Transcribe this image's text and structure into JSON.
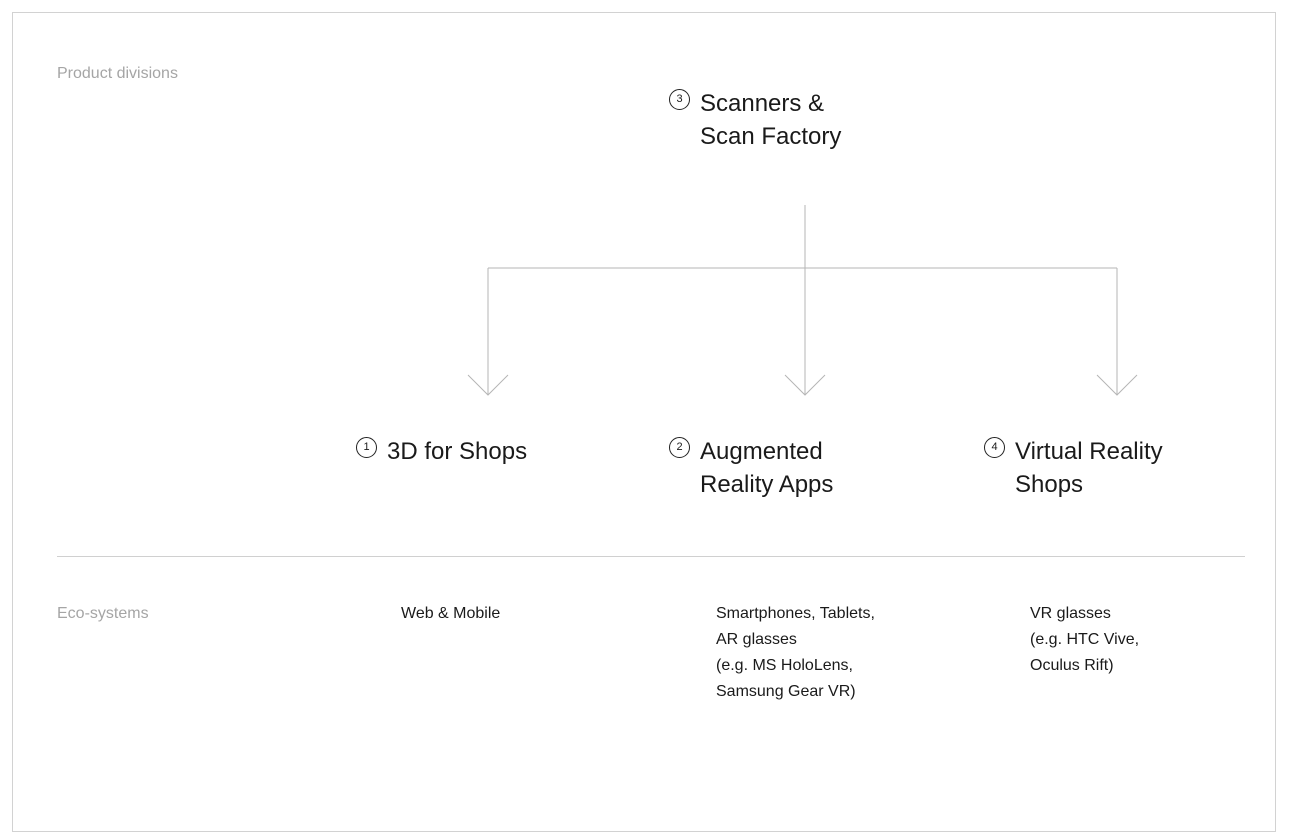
{
  "sections": {
    "product_divisions_label": "Product divisions",
    "eco_systems_label": "Eco-systems"
  },
  "top_node": {
    "number": "3",
    "label": "Scanners &\nScan Factory"
  },
  "bottom_nodes": [
    {
      "number": "1",
      "label": "3D for Shops"
    },
    {
      "number": "2",
      "label": "Augmented\nReality Apps"
    },
    {
      "number": "4",
      "label": "Virtual Reality\nShops"
    }
  ],
  "eco_systems": [
    {
      "text": "Web & Mobile"
    },
    {
      "text": "Smartphones, Tablets,\nAR glasses\n(e.g. MS HoloLens,\nSamsung Gear VR)"
    },
    {
      "text": "VR glasses\n(e.g. HTC Vive,\nOculus Rift)"
    }
  ],
  "colors": {
    "line": "#b5b5b5",
    "label_muted": "#a5a5a5",
    "text": "#1a1a1a"
  }
}
